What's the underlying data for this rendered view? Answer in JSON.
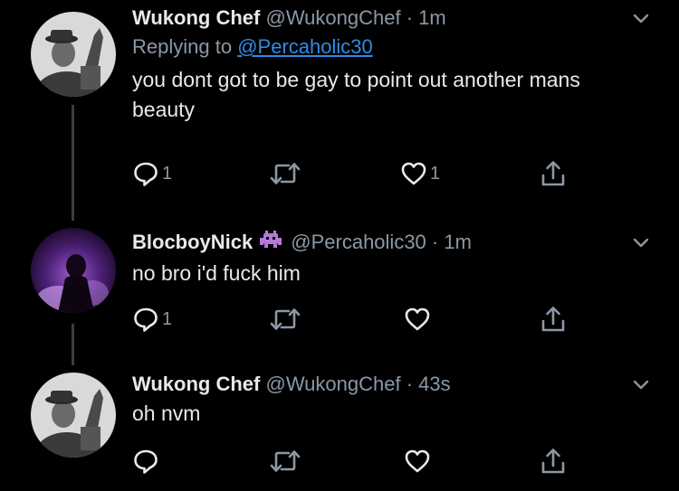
{
  "tweets": [
    {
      "name": "Wukong Chef",
      "handle": "@WukongChef",
      "time": "· 1m",
      "reply_prefix": "Replying to",
      "reply_mention": "@Percaholic30",
      "text": "you dont got to be gay to point out another mans beauty",
      "reply_count": "1",
      "like_count": "1"
    },
    {
      "name": "BlocboyNick",
      "handle": "@Percaholic30",
      "time": "· 1m",
      "text": "no bro i'd fuck him",
      "reply_count": "1",
      "badge_icon": "alien-invader-emoji-icon"
    },
    {
      "name": "Wukong Chef",
      "handle": "@WukongChef",
      "time": "· 43s",
      "text": "oh nvm"
    }
  ],
  "colors": {
    "background": "#000000",
    "text": "#e7e9ea",
    "secondary": "#8b98a5",
    "link": "#2f8ce8",
    "thread_line": "#3a3d40",
    "badge_purple": "#b37bd6"
  },
  "icons": [
    "reply-icon",
    "retweet-icon",
    "like-icon",
    "share-icon",
    "chevron-down-icon"
  ]
}
